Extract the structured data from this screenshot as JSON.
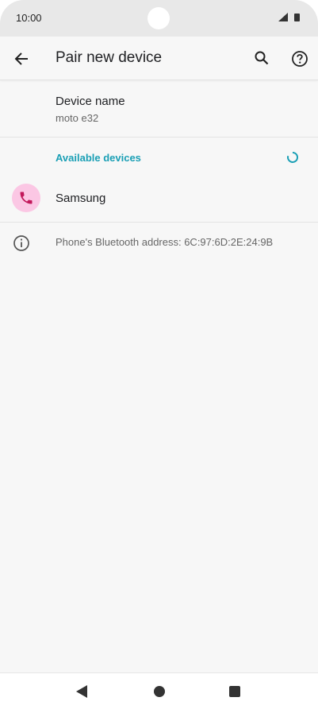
{
  "status_bar": {
    "time": "10:00"
  },
  "app_bar": {
    "title": "Pair new device",
    "back_icon": "arrow-left-icon",
    "search_icon": "search-icon",
    "help_icon": "help-circle-icon"
  },
  "device_name": {
    "label": "Device name",
    "value": "moto e32"
  },
  "available_devices": {
    "header": "Available devices",
    "items": [
      {
        "name": "Samsung",
        "icon": "phone-icon",
        "icon_bg": "#fbc7e4",
        "icon_color": "#c2185b"
      }
    ]
  },
  "bluetooth_info": {
    "text": "Phone's Bluetooth address: 6C:97:6D:2E:24:9B",
    "icon": "info-icon"
  },
  "colors": {
    "accent": "#1a9fb5"
  }
}
